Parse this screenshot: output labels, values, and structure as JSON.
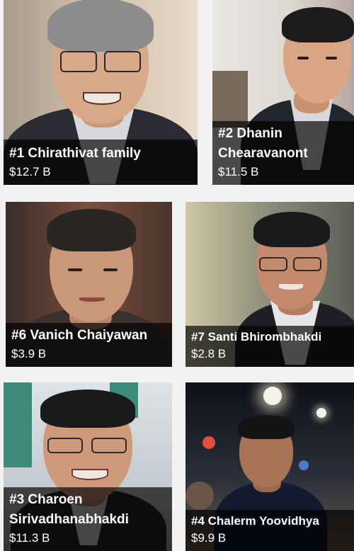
{
  "cards": [
    {
      "id": "chirathivat",
      "name": "#1 Chirathivat family",
      "net_worth": "$12.7 B",
      "photo_colors": {
        "bg": "#c9b7a2",
        "suit": "#2b2b33",
        "skin": "#d7a98a",
        "hair": "#8a8a8a"
      }
    },
    {
      "id": "chearavanont",
      "name_line1": "#2 Dhanin",
      "name_line2": "Chearavanont",
      "net_worth": "$11.5 B",
      "photo_colors": {
        "bg": "#e6e2dc",
        "suit": "#23252e",
        "skin": "#d9a584",
        "hair": "#1c1c1c"
      }
    },
    {
      "id": "chaiyawan",
      "name": "#6 Vanich Chaiyawan",
      "net_worth": "$3.9 B",
      "photo_colors": {
        "bg": "#6e4a3a",
        "suit": "#3a3030",
        "skin": "#c9977a",
        "hair": "#2a2624"
      }
    },
    {
      "id": "bhirombhakdi",
      "name": "#7 Santi Bhirombhakdi",
      "net_worth": "$2.8 B",
      "photo_colors": {
        "bg": "#8a8c7a",
        "suit": "#1e1f24",
        "skin": "#c48a6e",
        "hair": "#1a1a1a"
      }
    },
    {
      "id": "sirivadhanabhakdi",
      "name_line1": "#3 Charoen",
      "name_line2": "Sirivadhanabhakdi",
      "net_worth": "$11.3 B",
      "photo_colors": {
        "bg": "#c5cbd2",
        "suit": "#24262c",
        "skin": "#cf9a7c",
        "hair": "#1a1a1a",
        "sign": "#3c8a7a"
      }
    },
    {
      "id": "yoovidhya",
      "name": "#4 Chalerm Yoovidhya",
      "net_worth": "$9.9 B",
      "photo_colors": {
        "bg": "#1b1e26",
        "suit": "#141a30",
        "skin": "#a87458",
        "hair": "#141414"
      }
    }
  ]
}
